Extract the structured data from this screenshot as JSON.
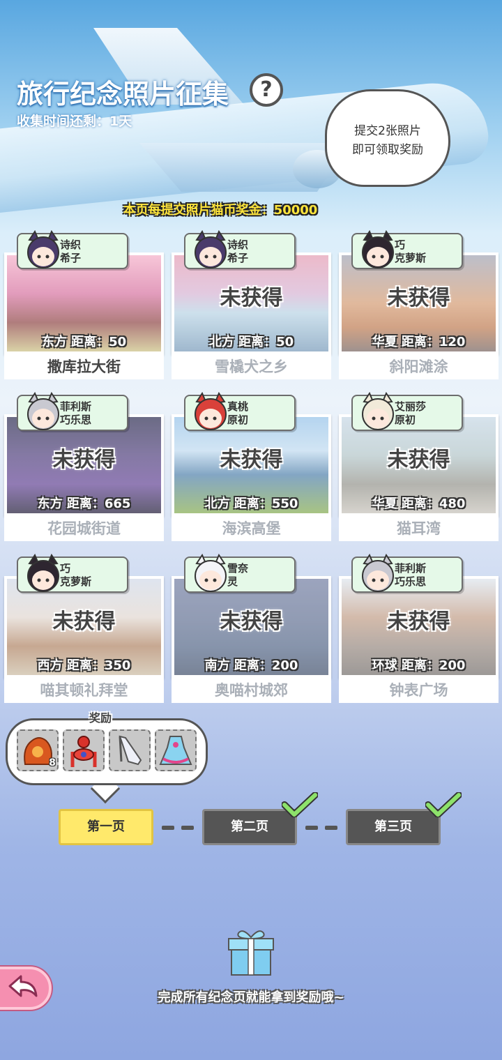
{
  "header": {
    "title": "旅行纪念照片征集",
    "help_label": "?",
    "countdown": "收集时间还剩：1天",
    "bubble_line1": "提交2张照片",
    "bubble_line2": "即可领取奖励",
    "bonus_text": "本页每提交照片猫币奖金：50000"
  },
  "cards": [
    {
      "char_line1": "诗织",
      "char_line2": "希子",
      "direction": "东方  距离：50",
      "place": "撒库拉大街",
      "status": "",
      "scene": "cherry"
    },
    {
      "char_line1": "诗织",
      "char_line2": "希子",
      "direction": "北方  距离：50",
      "place": "雪橇犬之乡",
      "status": "未获得",
      "scene": "ice"
    },
    {
      "char_line1": "巧",
      "char_line2": "克萝斯",
      "direction": "华夏  距离：120",
      "place": "斜阳滩涂",
      "status": "未获得",
      "scene": "sunset"
    },
    {
      "char_line1": "菲利斯",
      "char_line2": "巧乐思",
      "direction": "东方  距离：665",
      "place": "花园城街道",
      "status": "未获得",
      "scene": "night"
    },
    {
      "char_line1": "真桃",
      "char_line2": "原初",
      "direction": "北方  距离：550",
      "place": "海滨高堡",
      "status": "未获得",
      "scene": "coast"
    },
    {
      "char_line1": "艾丽莎",
      "char_line2": "原初",
      "direction": "华夏  距离：480",
      "place": "猫耳湾",
      "status": "未获得",
      "scene": "bay"
    },
    {
      "char_line1": "巧",
      "char_line2": "克萝斯",
      "direction": "西方  距离：350",
      "place": "喵其顿礼拜堂",
      "status": "未获得",
      "scene": "church"
    },
    {
      "char_line1": "雪奈",
      "char_line2": "灵",
      "direction": "南方  距离：200",
      "place": "奥喵村城郊",
      "status": "未获得",
      "scene": "dusk"
    },
    {
      "char_line1": "菲利斯",
      "char_line2": "巧乐思",
      "direction": "环球  距离：200",
      "place": "钟表广场",
      "status": "未获得",
      "scene": "square"
    }
  ],
  "reward": {
    "title": "奖励",
    "items": [
      {
        "icon": "cat-food-bag-icon",
        "count": "8"
      },
      {
        "icon": "red-lantern-ornament-icon",
        "count": ""
      },
      {
        "icon": "silver-high-heel-icon",
        "count": ""
      },
      {
        "icon": "frilly-dress-icon",
        "count": ""
      }
    ]
  },
  "pages": [
    {
      "label": "第一页",
      "active": true,
      "completed": false
    },
    {
      "label": "第二页",
      "active": false,
      "completed": true
    },
    {
      "label": "第三页",
      "active": false,
      "completed": true
    }
  ],
  "footer": {
    "text": "完成所有纪念页就能拿到奖励哦~"
  },
  "colors": {
    "tag_bg": "#e5f9e8",
    "active_tab": "#ffe96b",
    "inactive_tab": "#555555",
    "check_green": "#8de26b",
    "bonus_yellow": "#ffe53b",
    "back_pink": "#f58fb0"
  }
}
